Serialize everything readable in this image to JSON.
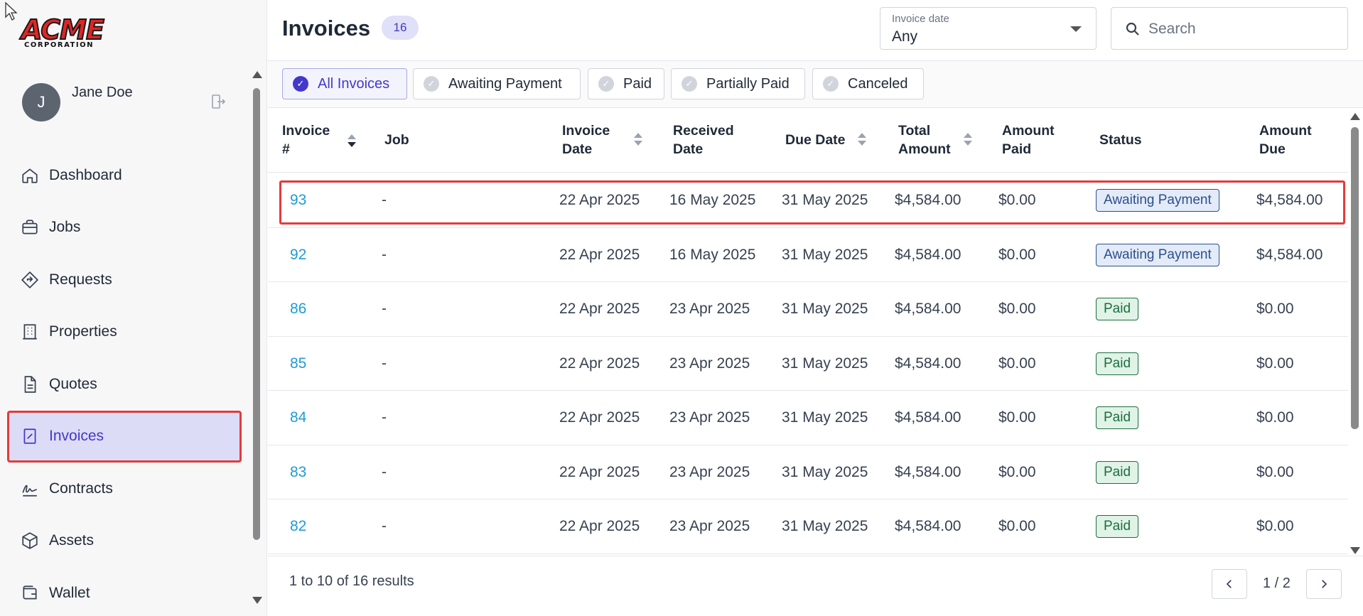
{
  "sidebar": {
    "logo": {
      "line1": "ACME",
      "line2": "CORPORATION"
    },
    "user": {
      "initial": "J",
      "name": "Jane Doe"
    },
    "items": [
      {
        "label": "Dashboard",
        "icon": "home-icon"
      },
      {
        "label": "Jobs",
        "icon": "briefcase-icon"
      },
      {
        "label": "Requests",
        "icon": "diamond-arrow-icon"
      },
      {
        "label": "Properties",
        "icon": "building-icon"
      },
      {
        "label": "Quotes",
        "icon": "document-icon"
      },
      {
        "label": "Invoices",
        "icon": "receipt-icon",
        "active": true
      },
      {
        "label": "Contracts",
        "icon": "signature-icon"
      },
      {
        "label": "Assets",
        "icon": "cube-icon"
      },
      {
        "label": "Wallet",
        "icon": "wallet-icon"
      }
    ]
  },
  "header": {
    "title": "Invoices",
    "count": "16",
    "date_filter": {
      "label": "Invoice date",
      "value": "Any"
    },
    "search": {
      "placeholder": "Search"
    }
  },
  "filters": {
    "all": "All Invoices",
    "awaiting": "Awaiting Payment",
    "paid": "Paid",
    "partial": "Partially Paid",
    "canceled": "Canceled"
  },
  "table": {
    "columns": {
      "invoice": "Invoice #",
      "job": "Job",
      "invoice_date": "Invoice Date",
      "received_date": "Received Date",
      "due_date": "Due Date",
      "total": "Total Amount",
      "paid": "Amount Paid",
      "status": "Status",
      "due": "Amount Due"
    },
    "rows": [
      {
        "invoice": "93",
        "job": "-",
        "invoice_date": "22 Apr 2025",
        "received_date": "16 May 2025",
        "due_date": "31 May 2025",
        "total": "$4,584.00",
        "paid": "$0.00",
        "status": "Awaiting Payment",
        "due": "$4,584.00"
      },
      {
        "invoice": "92",
        "job": "-",
        "invoice_date": "22 Apr 2025",
        "received_date": "16 May 2025",
        "due_date": "31 May 2025",
        "total": "$4,584.00",
        "paid": "$0.00",
        "status": "Awaiting Payment",
        "due": "$4,584.00"
      },
      {
        "invoice": "86",
        "job": "-",
        "invoice_date": "22 Apr 2025",
        "received_date": "23 Apr 2025",
        "due_date": "31 May 2025",
        "total": "$4,584.00",
        "paid": "$0.00",
        "status": "Paid",
        "due": "$0.00"
      },
      {
        "invoice": "85",
        "job": "-",
        "invoice_date": "22 Apr 2025",
        "received_date": "23 Apr 2025",
        "due_date": "31 May 2025",
        "total": "$4,584.00",
        "paid": "$0.00",
        "status": "Paid",
        "due": "$0.00"
      },
      {
        "invoice": "84",
        "job": "-",
        "invoice_date": "22 Apr 2025",
        "received_date": "23 Apr 2025",
        "due_date": "31 May 2025",
        "total": "$4,584.00",
        "paid": "$0.00",
        "status": "Paid",
        "due": "$0.00"
      },
      {
        "invoice": "83",
        "job": "-",
        "invoice_date": "22 Apr 2025",
        "received_date": "23 Apr 2025",
        "due_date": "31 May 2025",
        "total": "$4,584.00",
        "paid": "$0.00",
        "status": "Paid",
        "due": "$0.00"
      },
      {
        "invoice": "82",
        "job": "-",
        "invoice_date": "22 Apr 2025",
        "received_date": "23 Apr 2025",
        "due_date": "31 May 2025",
        "total": "$4,584.00",
        "paid": "$0.00",
        "status": "Paid",
        "due": "$0.00"
      }
    ]
  },
  "footer": {
    "results": "1 to 10 of 16 results",
    "page": "1 / 2"
  },
  "colors": {
    "accent": "#4338ca",
    "link": "#1d9bd8",
    "highlight": "#e23b3b",
    "awaiting": "#2c4f8a",
    "paid": "#1f6d3f"
  }
}
